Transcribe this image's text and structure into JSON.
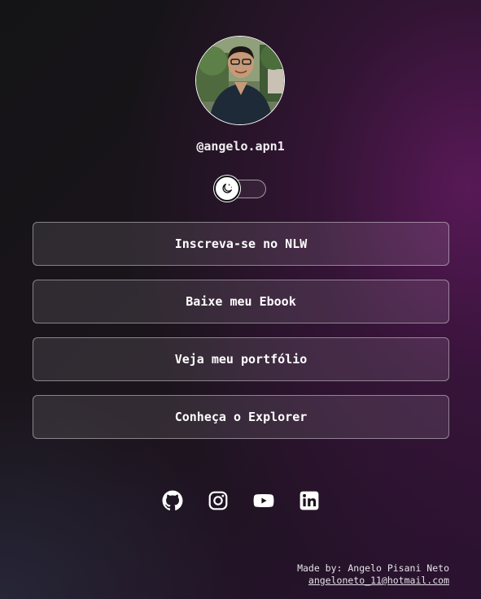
{
  "profile": {
    "username": "@angelo.apn1",
    "avatar_alt": "Angelo Pisani Neto"
  },
  "theme_switch": {
    "icon": "moon-icon",
    "state": "dark"
  },
  "links": [
    {
      "label": "Inscreva-se no NLW"
    },
    {
      "label": "Baixe meu Ebook"
    },
    {
      "label": "Veja meu portfólio"
    },
    {
      "label": "Conheça o Explorer"
    }
  ],
  "social": [
    {
      "icon": "github-icon"
    },
    {
      "icon": "instagram-icon"
    },
    {
      "icon": "youtube-icon"
    },
    {
      "icon": "linkedin-icon"
    }
  ],
  "footer": {
    "made_by": "Made by: Angelo Pisani Neto",
    "email": "angeloneto_11@hotmail.com"
  },
  "colors": {
    "background_dark": "#141416",
    "background_accent": "#621a60",
    "text": "#ffffff"
  }
}
